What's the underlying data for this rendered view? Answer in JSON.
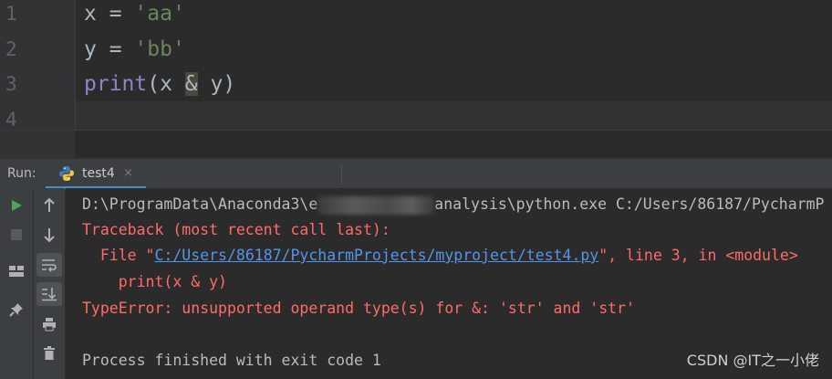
{
  "editor": {
    "line_numbers": [
      "1",
      "2",
      "3",
      "4"
    ],
    "lines": {
      "l1": {
        "var": "x",
        "op": " = ",
        "str": "'aa'"
      },
      "l2": {
        "var": "y",
        "op": " = ",
        "str": "'bb'"
      },
      "l3": {
        "func": "print",
        "open": "(x ",
        "amp": "&",
        "close": " y)"
      }
    }
  },
  "run": {
    "label": "Run:",
    "tab": "test4",
    "tab_close": "×",
    "icons": [
      "run-icon",
      "stop-icon",
      "up-arrow-icon",
      "down-arrow-icon",
      "soft-wrap-icon",
      "scroll-to-end-icon",
      "print-icon",
      "trash-icon",
      "layout-icon",
      "pin-icon"
    ]
  },
  "console": {
    "cmd_prefix": "D:\\ProgramData\\Anaconda3\\e",
    "cmd_suffix": "analysis\\python.exe C:/Users/86187/PycharmP",
    "traceback": "Traceback (most recent call last):",
    "file_prefix": "  File \"",
    "file_link": "C:/Users/86187/PycharmProjects/myproject/test4.py",
    "file_suffix": "\", line 3, in <module>",
    "code_line": "    print(x & y)",
    "error": "TypeError: unsupported operand type(s) for &: 'str' and 'str'",
    "finished": "Process finished with exit code 1"
  },
  "watermark": "CSDN @IT之一小佬",
  "colors": {
    "accent": "#4a88c7",
    "error": "#ff6b68",
    "link": "#5394ec",
    "run_green": "#4fa35b"
  }
}
